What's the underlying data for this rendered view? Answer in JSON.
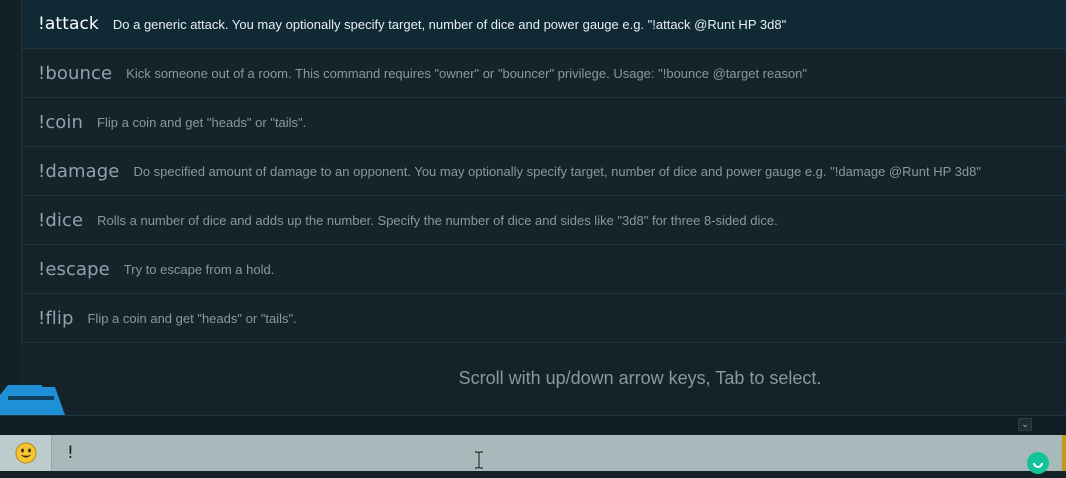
{
  "commands": [
    {
      "name": "!attack",
      "desc": "Do a generic attack. You may optionally specify target, number of dice and power gauge e.g. \"!attack @Runt HP 3d8\"",
      "selected": true
    },
    {
      "name": "!bounce",
      "desc": "Kick someone out of a room. This command requires \"owner\" or \"bouncer\" privilege. Usage: \"!bounce @target reason\""
    },
    {
      "name": "!coin",
      "desc": "Flip a coin and get \"heads\" or \"tails\"."
    },
    {
      "name": "!damage",
      "desc": "Do specified amount of damage to an opponent. You may optionally specify target, number of dice and power gauge e.g. \"!damage @Runt HP 3d8\""
    },
    {
      "name": "!dice",
      "desc": "Rolls a number of dice and adds up the number. Specify the number of dice and sides like \"3d8\" for three 8-sided dice."
    },
    {
      "name": "!escape",
      "desc": "Try to escape from a hold."
    },
    {
      "name": "!flip",
      "desc": "Flip a coin and get \"heads\" or \"tails\"."
    }
  ],
  "hint": "Scroll with up/down arrow keys, Tab to select.",
  "input": {
    "value": "!"
  },
  "icons": {
    "emoji": "smiley-face-icon",
    "expand": "chevron-down-icon",
    "grammar": "grammarly-icon",
    "cursor": "text-cursor-icon"
  },
  "colors": {
    "selected_row": "#0f2a35",
    "accent_blue": "#1f8fd6",
    "input_bg": "#a8b9bb",
    "grammar_green": "#15c39a",
    "right_bar": "#c49a1e"
  }
}
